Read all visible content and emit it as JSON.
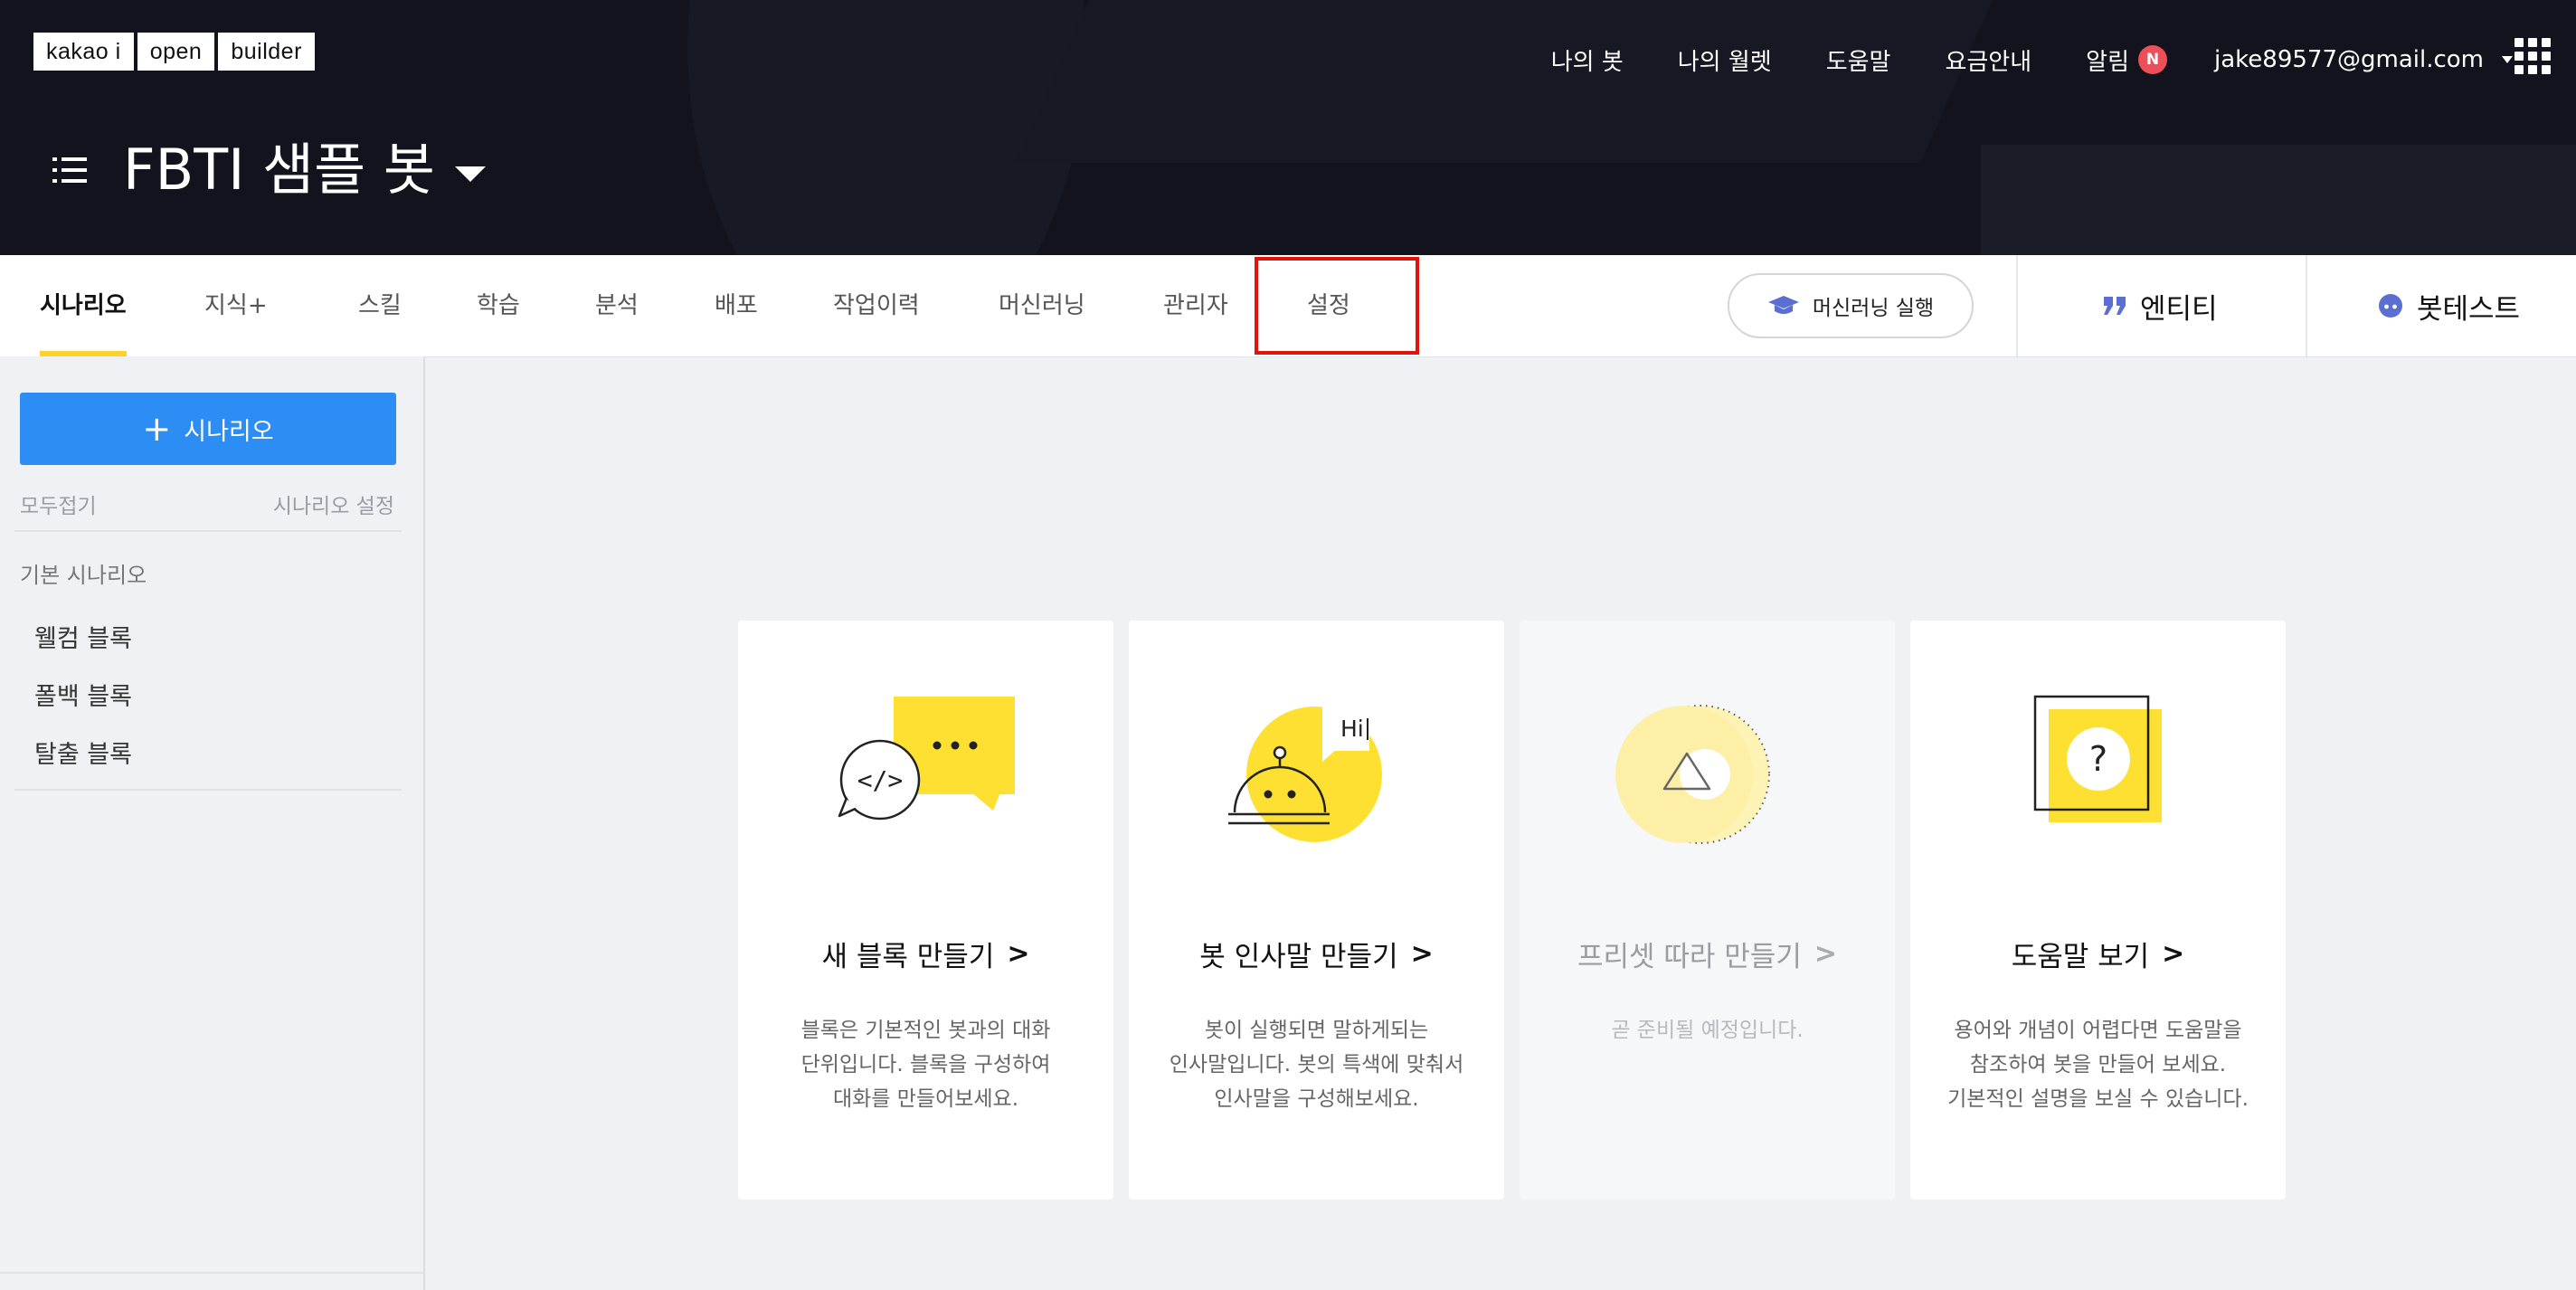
{
  "logo": {
    "parts": [
      "kakao i",
      "open",
      "builder"
    ]
  },
  "top_nav": {
    "my_bots": "나의 봇",
    "my_wallet": "나의 월렛",
    "help": "도움말",
    "pricing": "요금안내",
    "notifications": "알림",
    "notification_badge": "N",
    "user_email": "jake89577@gmail.com"
  },
  "bot": {
    "title": "FBTI 샘플 봇"
  },
  "tabs": [
    {
      "label": "시나리오",
      "active": true
    },
    {
      "label": "지식+"
    },
    {
      "label": "스킬"
    },
    {
      "label": "학습"
    },
    {
      "label": "분석"
    },
    {
      "label": "배포"
    },
    {
      "label": "작업이력"
    },
    {
      "label": "머신러닝"
    },
    {
      "label": "관리자"
    },
    {
      "label": "설정",
      "highlighted": true
    }
  ],
  "actions": {
    "ml_run": "머신러닝 실행",
    "entity": "엔티티",
    "bot_test": "봇테스트"
  },
  "sidebar": {
    "add_scenario": "시나리오",
    "collapse_all": "모두접기",
    "scenario_settings": "시나리오 설정",
    "section_title": "기본 시나리오",
    "items": [
      "웰컴 블록",
      "폴백 블록",
      "탈출 블록"
    ]
  },
  "cards": [
    {
      "title": "새 블록 만들기",
      "desc": [
        "블록은 기본적인 봇과의 대화",
        "단위입니다. 블록을 구성하여",
        "대화를 만들어보세요."
      ],
      "icon": "chat-code-icon"
    },
    {
      "title": "봇 인사말 만들기",
      "desc": [
        "봇이 실행되면 말하게되는",
        "인사말입니다. 봇의 특색에 맞춰서",
        "인사말을 구성해보세요."
      ],
      "icon": "bot-hi-icon",
      "icon_text": "Hi"
    },
    {
      "title": "프리셋 따라 만들기",
      "desc": [
        "곧 준비될 예정입니다."
      ],
      "disabled": true,
      "icon": "preset-triangle-icon"
    },
    {
      "title": "도움말 보기",
      "desc": [
        "용어와 개념이 어렵다면 도움말을",
        "참조하여 봇을 만들어 보세요.",
        "기본적인 설명을 보실 수 있습니다."
      ],
      "icon": "help-question-icon",
      "icon_text": "?"
    }
  ],
  "colors": {
    "accent_yellow": "#fee033",
    "primary_blue": "#2c8ef4",
    "highlight_red": "#e3120b",
    "header_bg": "#12131c"
  }
}
